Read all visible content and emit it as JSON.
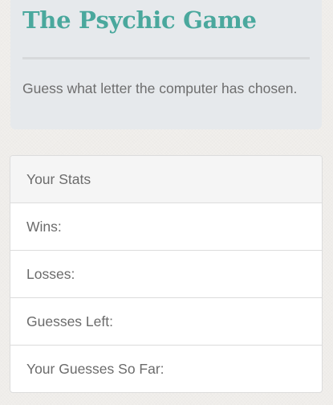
{
  "header": {
    "title": "The Psychic Game",
    "subtitle": "Guess what letter the computer has chosen."
  },
  "stats": {
    "heading": "Your Stats",
    "rows": [
      {
        "label": "Wins:",
        "value": ""
      },
      {
        "label": "Losses:",
        "value": ""
      },
      {
        "label": "Guesses Left:",
        "value": ""
      },
      {
        "label": "Your Guesses So Far:",
        "value": ""
      }
    ]
  },
  "colors": {
    "title": "#4aa89d",
    "jumbotron_bg": "#e6e9ec",
    "page_bg": "#f1efec",
    "text": "#6b6b6b"
  }
}
